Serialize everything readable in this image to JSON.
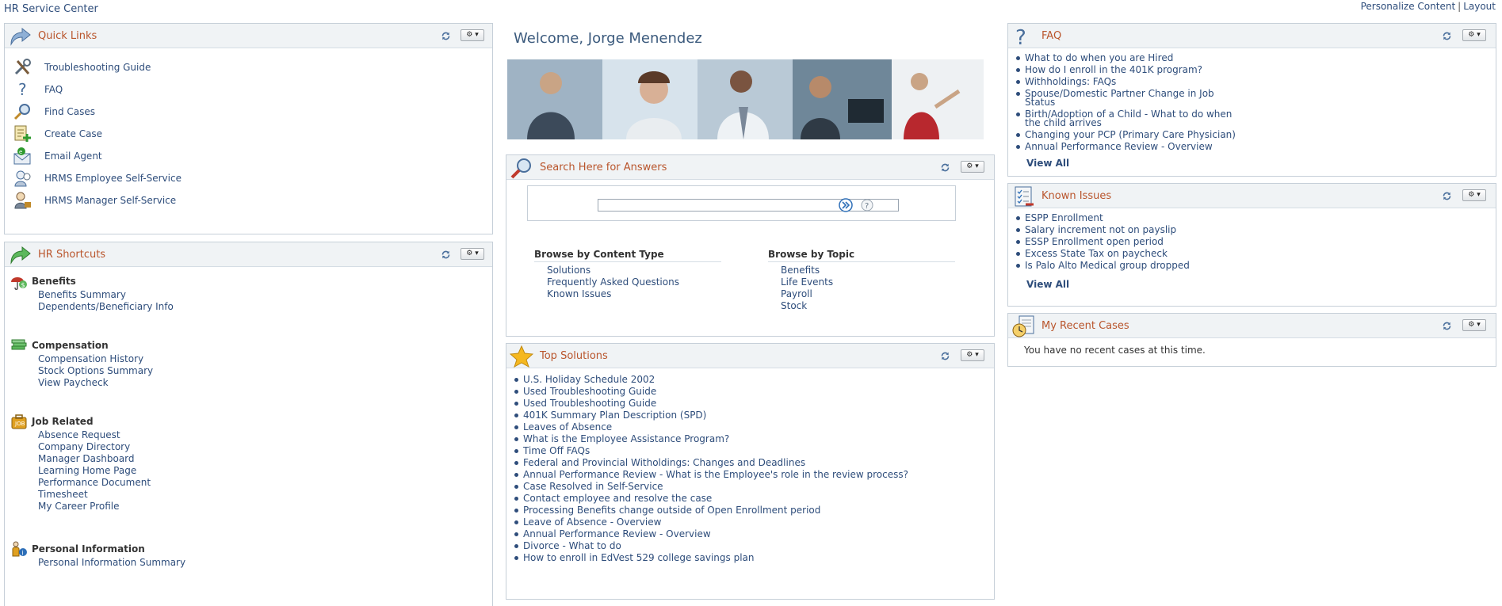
{
  "page": {
    "title": "HR Service Center"
  },
  "top_links": {
    "personalize": "Personalize Content",
    "separator": "|",
    "layout": "Layout"
  },
  "quick_links": {
    "title": "Quick Links",
    "items": [
      {
        "label": "Troubleshooting Guide",
        "icon": "tools-icon"
      },
      {
        "label": "FAQ",
        "icon": "question-icon"
      },
      {
        "label": "Find Cases",
        "icon": "magnifier-icon"
      },
      {
        "label": "Create Case",
        "icon": "create-case-icon"
      },
      {
        "label": "Email Agent",
        "icon": "email-icon"
      },
      {
        "label": "HRMS Employee Self-Service",
        "icon": "employee-icon"
      },
      {
        "label": "HRMS Manager Self-Service",
        "icon": "manager-icon"
      }
    ]
  },
  "hr_shortcuts": {
    "title": "HR Shortcuts",
    "groups": [
      {
        "title": "Benefits",
        "items": [
          "Benefits Summary",
          "Dependents/Beneficiary Info"
        ]
      },
      {
        "title": "Compensation",
        "items": [
          "Compensation History",
          "Stock Options Summary",
          "View Paycheck"
        ]
      },
      {
        "title": "Job Related",
        "items": [
          "Absence Request",
          "Company Directory",
          "Manager Dashboard",
          "Learning Home Page",
          "Performance Document",
          "Timesheet",
          "My Career Profile"
        ]
      },
      {
        "title": "Personal Information",
        "items": [
          "Personal Information Summary"
        ]
      }
    ]
  },
  "welcome": {
    "text": "Welcome, Jorge Menendez"
  },
  "search": {
    "title": "Search Here for Answers",
    "input_value": "",
    "browse_content": {
      "title": "Browse by Content Type",
      "items": [
        "Solutions",
        "Frequently Asked Questions",
        "Known Issues"
      ]
    },
    "browse_topic": {
      "title": "Browse by Topic",
      "items": [
        "Benefits",
        "Life Events",
        "Payroll",
        "Stock"
      ]
    }
  },
  "top_solutions": {
    "title": "Top Solutions",
    "items": [
      "U.S. Holiday Schedule 2002",
      "Used Troubleshooting Guide",
      "Used Troubleshooting Guide",
      "401K Summary Plan Description (SPD)",
      "Leaves of Absence",
      "What is the Employee Assistance Program?",
      "Time Off FAQs",
      "Federal and Provincial Witholdings: Changes and Deadlines",
      "Annual Performance Review - What is the Employee's role in the review process?",
      "Case Resolved in Self-Service",
      "Contact employee and resolve the case",
      "Processing Benefits change outside of Open Enrollment period",
      "Leave of Absence - Overview",
      "Annual Performance Review - Overview",
      "Divorce - What to do",
      "How to enroll in EdVest 529 college savings plan"
    ]
  },
  "faq": {
    "title": "FAQ",
    "items": [
      "What to do when you are Hired",
      "How do I enroll in the 401K program?",
      "Withholdings: FAQs",
      "Spouse/Domestic Partner Change in Job Status",
      "Birth/Adoption of a Child - What to do when the child arrives",
      "Changing your PCP (Primary Care Physician)",
      "Annual Performance Review - Overview"
    ],
    "view_all": "View All"
  },
  "known_issues": {
    "title": "Known Issues",
    "items": [
      "ESPP Enrollment",
      "Salary increment not on payslip",
      "ESSP Enrollment open period",
      "Excess State Tax on paycheck",
      "Is Palo Alto Medical group dropped"
    ],
    "view_all": "View All"
  },
  "recent_cases": {
    "title": "My Recent Cases",
    "empty_text": "You have no recent cases at this time."
  },
  "colors": {
    "link": "#2e4d7b",
    "pagelet_title": "#b9552c",
    "header_bg": "#f0f3f5",
    "border": "#c6cfd8"
  }
}
